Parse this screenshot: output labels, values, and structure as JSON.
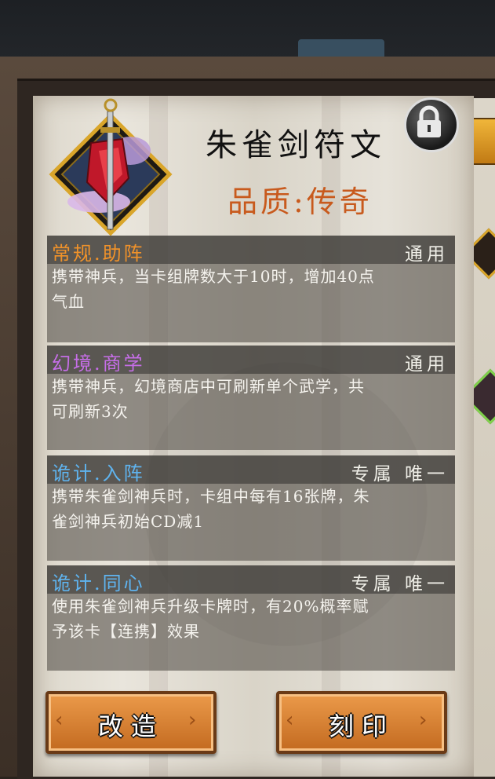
{
  "header": {
    "title": "朱雀剑符文",
    "quality": "品质:传奇"
  },
  "skills": [
    {
      "name": "常规.助阵",
      "tag": "通用",
      "desc_line1": "携带神兵，当卡组牌数大于10时，增加40点",
      "desc_line2": "气血",
      "color": "#f0922a"
    },
    {
      "name": "幻境.商学",
      "tag": "通用",
      "desc_line1": "携带神兵，幻境商店中可刷新单个武学，共",
      "desc_line2": "可刷新3次",
      "color": "#c66ee8"
    },
    {
      "name": "诡计.入阵",
      "tag": "专属 唯一",
      "desc_line1": "携带朱雀剑神兵时，卡组中每有16张牌，朱",
      "desc_line2": "雀剑神兵初始CD减1",
      "color": "#5fb4f0"
    },
    {
      "name": "诡计.同心",
      "tag": "专属 唯一",
      "desc_line1": "使用朱雀剑神兵升级卡牌时，有20%概率赋",
      "desc_line2": "予该卡【连携】效果",
      "color": "#5fb4f0"
    }
  ],
  "actions": {
    "modify_label": "改造",
    "engrave_label": "刻印"
  },
  "icons": {
    "emblem": "sword-gem-emblem-icon",
    "lock": "lock-icon"
  },
  "colors": {
    "title": "#111111",
    "quality": "#c85a1d",
    "button": "#e08a3a"
  }
}
